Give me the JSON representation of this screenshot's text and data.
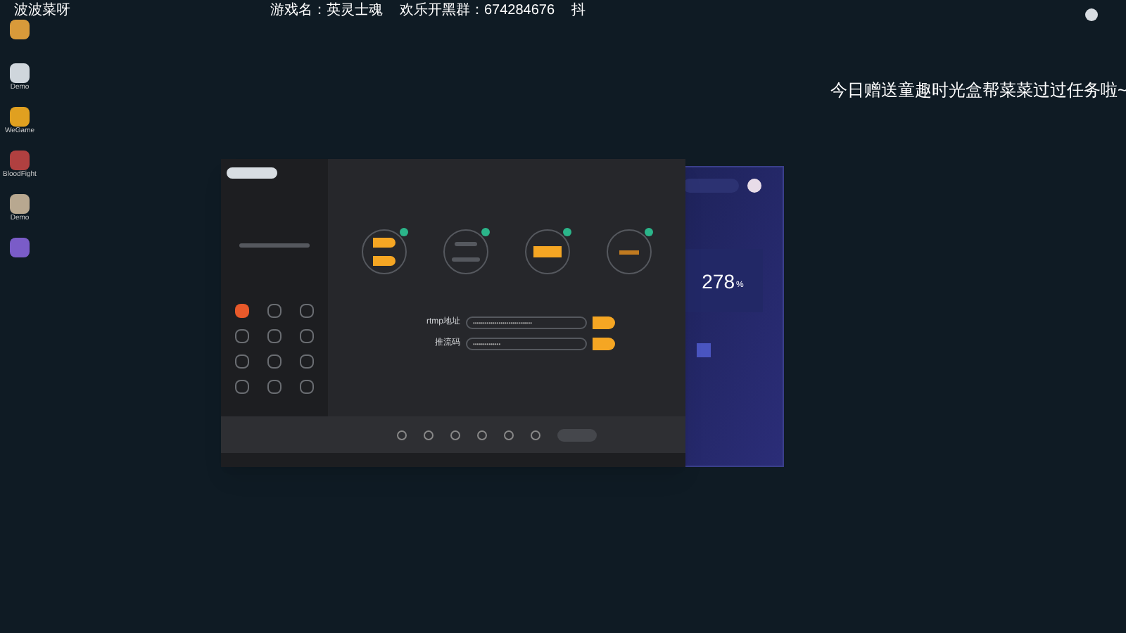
{
  "stream_overlay": {
    "streamer": "波波菜呀",
    "game": "游戏名：英灵士魂",
    "group": "欢乐开黑群：674284676",
    "platform": "抖",
    "banner": "今日赠送童趣时光盒帮菜菜过过任务啦~"
  },
  "desktop_icons": [
    {
      "color": "#d89a3a"
    },
    {
      "label": "Demo",
      "color": "#cfd6dc"
    },
    {
      "label": "WeGame",
      "color": "#e0a020"
    },
    {
      "label": "BloodFight",
      "color": "#b04040"
    },
    {
      "label": "Demo",
      "color": "#b8a890"
    },
    {
      "color": "#7a5cc8"
    }
  ],
  "live_app": {
    "steps": [
      {
        "kind": "pills",
        "done": true
      },
      {
        "kind": "text",
        "done": true
      },
      {
        "kind": "button",
        "done": true
      },
      {
        "kind": "label",
        "done": true
      }
    ],
    "fields": [
      {
        "label": "rtmp地址",
        "value": "••••••••••••••••••••••••••••••"
      },
      {
        "label": "推流码",
        "value": "••••••••••••••"
      }
    ],
    "tools": [
      {
        "highlight": true
      },
      {
        "highlight": false
      },
      {
        "highlight": false
      },
      {
        "highlight": false
      },
      {
        "highlight": false
      },
      {
        "highlight": false
      },
      {
        "highlight": false
      },
      {
        "highlight": false
      },
      {
        "highlight": false
      },
      {
        "highlight": false
      },
      {
        "highlight": false
      },
      {
        "highlight": false
      }
    ]
  },
  "side_app": {
    "value": "278",
    "unit": "%"
  }
}
